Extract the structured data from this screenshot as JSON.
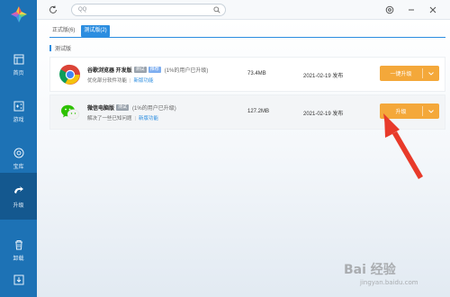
{
  "sidebar": {
    "items": [
      {
        "label": "首页",
        "icon": "home-icon"
      },
      {
        "label": "游戏",
        "icon": "game-icon"
      },
      {
        "label": "宝库",
        "icon": "treasury-icon"
      },
      {
        "label": "升级",
        "icon": "upgrade-icon",
        "active": true
      },
      {
        "label": "卸载",
        "icon": "uninstall-icon"
      },
      {
        "label": "",
        "icon": "download-icon"
      }
    ]
  },
  "topbar": {
    "search_value": "QQ"
  },
  "tabs": [
    {
      "label": "正式版(6)"
    },
    {
      "label": "测试版(2)",
      "active": true
    }
  ],
  "section": {
    "title": "测试版"
  },
  "apps": [
    {
      "name": "谷歌浏览器 开发版",
      "badge1": "测试",
      "badge2": "推荐",
      "users": "(1%的用户已升级)",
      "desc": "优化部分软件功能",
      "link": "新版功能",
      "size": "73.4MB",
      "date": "2021-02-19 发布",
      "button": "一键升级"
    },
    {
      "name": "微信电脑版",
      "badge1": "测试",
      "users": "(1%的用户已升级)",
      "desc": "解决了一些已知问题",
      "link": "新版功能",
      "size": "127.2MB",
      "date": "2021-02-19 发布",
      "button": "升级"
    }
  ],
  "watermark": {
    "main": "Bai 经验",
    "sub": "jingyan.baidu.com"
  },
  "colors": {
    "accent": "#2b8de0",
    "sidebar": "#1d72b5",
    "button": "#f4a83a",
    "arrow": "#e83a2a"
  }
}
